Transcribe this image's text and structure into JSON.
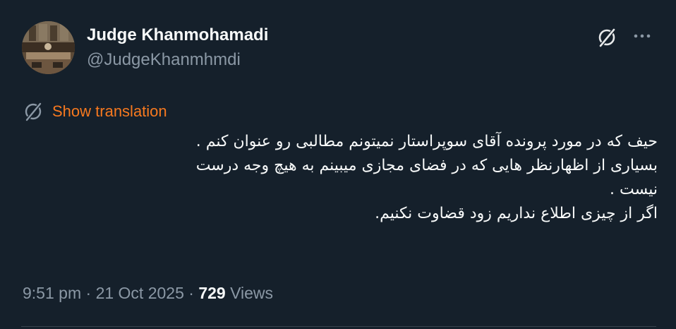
{
  "author": {
    "display_name": "Judge Khanmohamadi",
    "handle": "@JudgeKhanmhmdi",
    "avatar_icon": "courtroom-photo-avatar"
  },
  "actions": {
    "grok_icon": "grok-icon",
    "more_icon": "more-dots-icon"
  },
  "translation": {
    "icon": "grok-icon",
    "label": "Show translation",
    "color": "#f7791f"
  },
  "tweet": {
    "lines": [
      "حیف که در مورد پرونده آقای سوپراستار نمیتونم مطالبی رو عنوان کنم .",
      "بسیاری از اظهارنظر هایی که در فضای مجازی میبینم به هیچ وجه درست",
      "نیست .",
      "اگر از چیزی اطلاع نداریم زود قضاوت نکنیم."
    ]
  },
  "meta": {
    "time": "9:51 pm",
    "separator1": " · ",
    "date": "21 Oct 2025",
    "separator2": " · ",
    "views_count": "729",
    "views_label": " Views"
  },
  "colors": {
    "background": "#15202b",
    "text_primary": "#f7f9f9",
    "text_secondary": "#8b98a5",
    "accent": "#f7791f"
  }
}
